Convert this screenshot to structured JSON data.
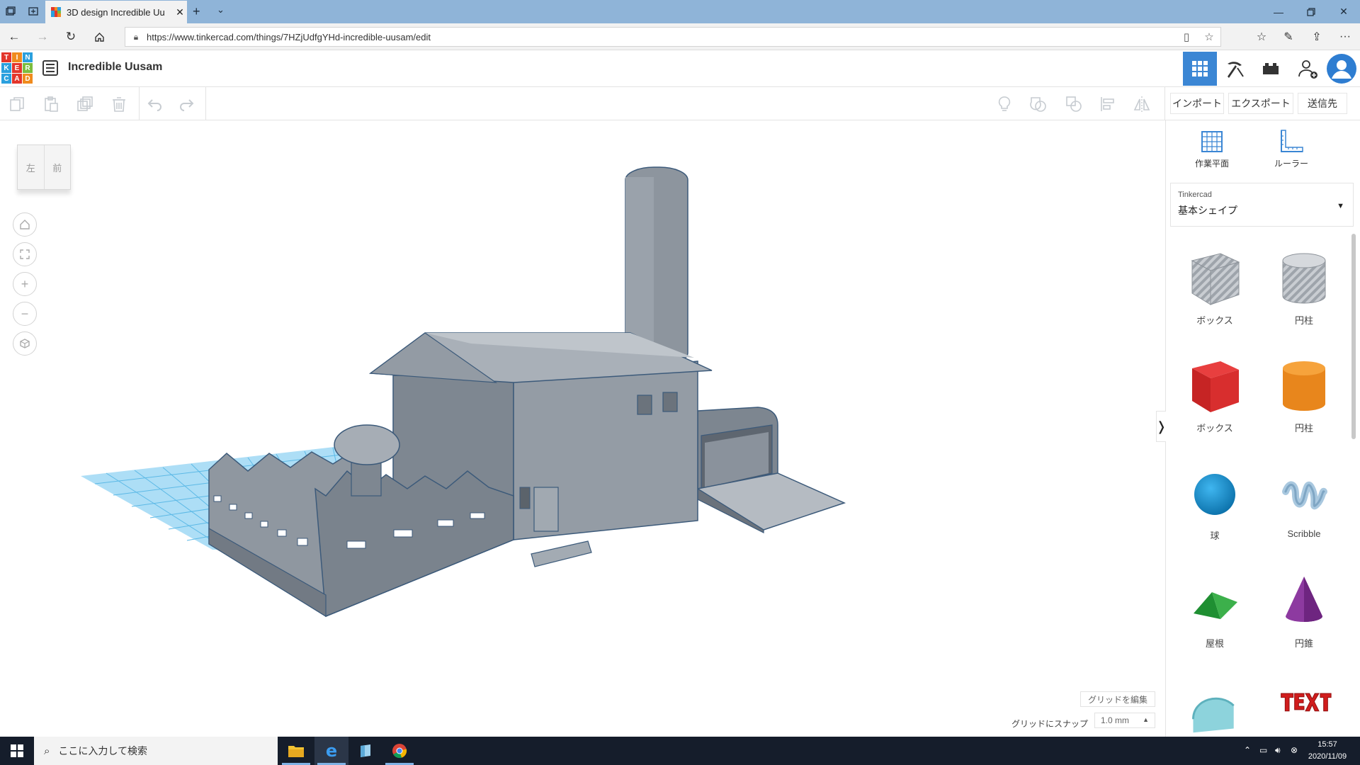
{
  "browser": {
    "tab_title": "3D design Incredible Uu",
    "url": "https://www.tinkercad.com/things/7HZjUdfgYHd-incredible-uusam/edit"
  },
  "app": {
    "logo_letters": [
      "T",
      "I",
      "N",
      "K",
      "E",
      "R",
      "C",
      "A",
      "D"
    ],
    "logo_colors": [
      "#e3362b",
      "#f08b1e",
      "#2aa0de",
      "#2aa0de",
      "#e3362b",
      "#7bbd3e",
      "#2aa0de",
      "#e3362b",
      "#f08b1e"
    ],
    "design_title": "Incredible Uusam",
    "accent": "#3b86d4"
  },
  "toolbar": {
    "import_label": "インポート",
    "export_label": "エクスポート",
    "send_label": "送信先"
  },
  "viewcube": {
    "left": "左",
    "front": "前"
  },
  "workspace": {
    "grid_edit_label": "グリッドを編集",
    "snap_label": "グリッドにスナップ",
    "snap_value": "1.0 mm"
  },
  "panel": {
    "workplane_label": "作業平面",
    "ruler_label": "ルーラー",
    "library_source": "Tinkercad",
    "library_name": "基本シェイプ",
    "shapes": [
      {
        "label": "ボックス",
        "icon": "box-hole-icon"
      },
      {
        "label": "円柱",
        "icon": "cylinder-hole-icon"
      },
      {
        "label": "ボックス",
        "icon": "box-icon"
      },
      {
        "label": "円柱",
        "icon": "cylinder-icon"
      },
      {
        "label": "球",
        "icon": "sphere-icon"
      },
      {
        "label": "Scribble",
        "icon": "scribble-icon"
      },
      {
        "label": "屋根",
        "icon": "roof-icon"
      },
      {
        "label": "円錐",
        "icon": "cone-icon"
      }
    ]
  },
  "taskbar": {
    "search_placeholder": "ここに入力して検索",
    "time": "15:57",
    "date": "2020/11/09"
  }
}
